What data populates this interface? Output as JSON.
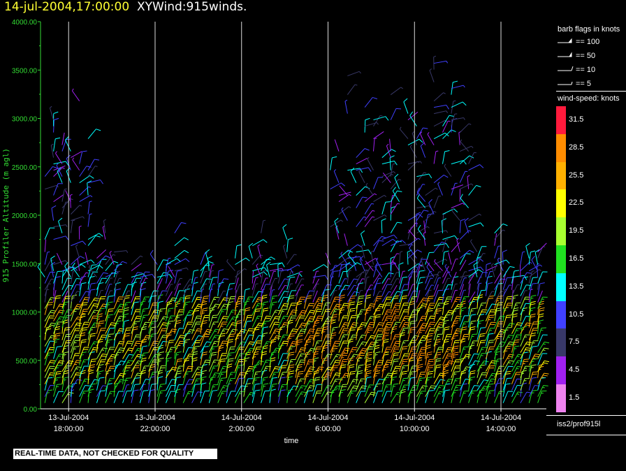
{
  "header": {
    "time": "14-jul-2004,17:00:00",
    "title": "XYWind:915winds."
  },
  "notice": "REAL-TIME DATA, NOT CHECKED FOR QUALITY",
  "legend": {
    "flags_title": "barb flags in knots",
    "flags": [
      {
        "icon": "pennant-barb-icon",
        "label": "== 100"
      },
      {
        "icon": "pennant-barb-icon",
        "label": "== 50"
      },
      {
        "icon": "full-barb-icon",
        "label": "== 10"
      },
      {
        "icon": "half-barb-icon",
        "label": "== 5"
      }
    ],
    "colorbar_title": "wind-speed: knots",
    "colorbar": [
      {
        "label": "31.5",
        "color": "#ff1a3c"
      },
      {
        "label": "28.5",
        "color": "#ff8c00"
      },
      {
        "label": "25.5",
        "color": "#ffb000"
      },
      {
        "label": "22.5",
        "color": "#ffff00"
      },
      {
        "label": "19.5",
        "color": "#a8ff30"
      },
      {
        "label": "16.5",
        "color": "#20e020"
      },
      {
        "label": "13.5",
        "color": "#00ffff"
      },
      {
        "label": "10.5",
        "color": "#4040ff"
      },
      {
        "label": "7.5",
        "color": "#383868"
      },
      {
        "label": "4.5",
        "color": "#a020f0"
      },
      {
        "label": "1.5",
        "color": "#ee82ee"
      }
    ],
    "source": "iss2/prof915l"
  },
  "chart_data": {
    "type": "wind-barb",
    "title": "XYWind:915winds.",
    "xlabel": "time",
    "ylabel": "915 Profiler Altitude (m agl)",
    "ylim": [
      0,
      4000
    ],
    "xlim_hours": [
      16.7,
      40.1
    ],
    "yticks": [
      "4000.00",
      "3500.00",
      "3000.00",
      "2500.00",
      "2000.00",
      "1500.00",
      "1000.00",
      "500.00",
      "0.00"
    ],
    "ytick_values": [
      4000,
      3500,
      3000,
      2500,
      2000,
      1500,
      1000,
      500,
      0
    ],
    "xticks": [
      {
        "hour": 18,
        "line1": "13-Jul-2004",
        "line2": "18:00:00"
      },
      {
        "hour": 22,
        "line1": "13-Jul-2004",
        "line2": "22:00:00"
      },
      {
        "hour": 26,
        "line1": "14-Jul-2004",
        "line2": "2:00:00"
      },
      {
        "hour": 30,
        "line1": "14-Jul-2004",
        "line2": "6:00:00"
      },
      {
        "hour": 34,
        "line1": "14-Jul-2004",
        "line2": "10:00:00"
      },
      {
        "hour": 38,
        "line1": "14-Jul-2004",
        "line2": "14:00:00"
      }
    ],
    "profile_interval_hours": 0.4,
    "grid": "vertical lines at x ticks",
    "colors": {
      "axis": "#33dd33",
      "grid": "#ffffff"
    }
  }
}
